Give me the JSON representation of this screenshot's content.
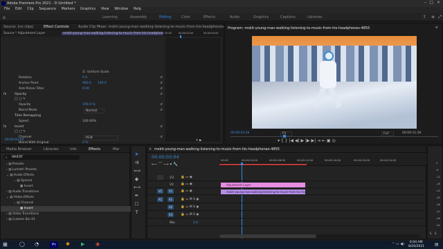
{
  "window": {
    "title": "Adobe Premiere Pro 2021 - D:\\Untitled *"
  },
  "menu": [
    "File",
    "Edit",
    "Clip",
    "Sequence",
    "Markers",
    "Graphics",
    "View",
    "Window",
    "Help"
  ],
  "workspaces": [
    "Learning",
    "Assembly",
    "Editing",
    "Color",
    "Effects",
    "Audio",
    "Graphics",
    "Captions",
    "Libraries"
  ],
  "source": {
    "tabs": [
      "Source: (no clips)",
      "Effect Controls",
      "Audio Clip Mixer: mskit-young-man-walking-listening-to-music-from-his-headphones-4"
    ],
    "breadcrumb": "Source * Adjustment Layer",
    "clip_path": "mskit-young-man-walking-listening-to-music-from-his-headphones-4",
    "times": [
      "00:00",
      "00:00:01:00",
      "00:00:02:00",
      "00:00:03:00",
      "00:00:04:00"
    ],
    "uniform_scale": "Uniform Scale",
    "rotation": {
      "label": "Rotation",
      "value": "0.0"
    },
    "anchor": {
      "label": "Anchor Point",
      "x": "960.0",
      "y": "540.0"
    },
    "antiflicker": {
      "label": "Anti-flicker Filter",
      "value": "0.00"
    },
    "opacity_section": "Opacity",
    "opacity": {
      "label": "Opacity",
      "value": "100.0 %"
    },
    "blend": {
      "label": "Blend Mode",
      "value": "Normal"
    },
    "time_remap": "Time Remapping",
    "speed": {
      "label": "Speed",
      "value": "100.00%"
    },
    "invert": "Invert",
    "channel": {
      "label": "Channel",
      "value": "RGB"
    },
    "blend_orig": {
      "label": "Blend With Original",
      "value": "0 %"
    },
    "timecode": "00:00:03:04"
  },
  "program": {
    "title": "Program: mskit-young-man-walking-listening-to-music-from-his-headphones-4855",
    "timecode": "00:00:03:04",
    "fit": "Fit",
    "quality": "Full",
    "duration": "00:00:11:26"
  },
  "project": {
    "tabs": [
      "Media Browser",
      "Libraries",
      "Info",
      "Effects",
      "Mar"
    ],
    "search": "INVERT",
    "tree": [
      "Presets",
      "Lumetri Presets",
      "Audio Effects",
      "Special",
      "Invert",
      "Audio Transitions",
      "Video Effects",
      "Channel",
      "Invert",
      "Video Transitions",
      "Custom Bin 01"
    ]
  },
  "timeline": {
    "title": "mskit-young-man-walking-listening-to-music-from-his-headphones-4855",
    "timecode": "00:00:03:04",
    "ruler": [
      "00:00",
      "00:00:04:00",
      "00:00:08:00",
      "00:00:12:00",
      "00:00:16:00",
      "00:00:20:00",
      "00:00:24:00"
    ],
    "tracks": [
      "V3",
      "V2",
      "V1",
      "A1",
      "A2",
      "A3"
    ],
    "mix": "Mix",
    "mix_val": "0.0",
    "clip_adj": "Adjustment Layer",
    "clip_video": "mskit-young-man-walking-listening-to-music-from-his-head",
    "meter": [
      "0",
      "-6",
      "-12",
      "-18",
      "-24",
      "-30",
      "-36",
      "-42",
      "-48",
      "-54"
    ],
    "meter_s": [
      "S",
      "S"
    ]
  },
  "clock": {
    "time": "6:04 AM",
    "date": "8/20/2021"
  },
  "taskbar": {
    "app": "Pr"
  }
}
